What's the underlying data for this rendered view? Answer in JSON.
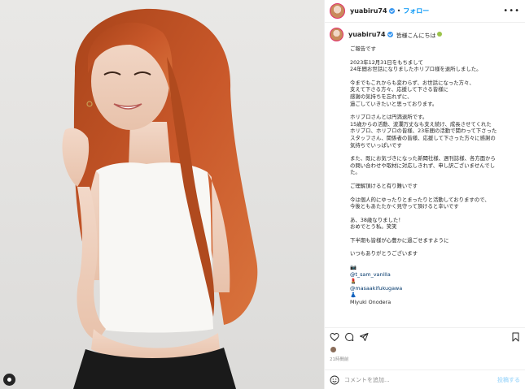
{
  "post": {
    "username": "yuabiru74",
    "follow_label": "フォロー",
    "dot": "•",
    "more_label": "•••"
  },
  "caption": {
    "greeting": "皆様こんにちは",
    "lines": [
      "ご報告です",
      "",
      "2023年12月31日をもちまして",
      "24年間お世話になりましたホリプロ様を退所しました。",
      "",
      "今までもこれからも変わらず、お世話になった方々、",
      "支えて下さる方々、応援して下さる皆様に",
      "感謝の気持ちを忘れずに、",
      "過ごしていきたいと思っております。",
      "",
      "ホリプロさんとは円満退所です。",
      "15歳からの活動、波瀾万丈なも支え続け、成長させてくれた",
      "ホリプロ、ホリプロの皆様、23年間の活動で関わって下さった",
      "スタッフさん、関係者の皆様、応援して下さった方々に感謝の",
      "気持ちでいっぱいです",
      "",
      "また、既にお気づきになった新聞社様、週刊誌様、各方面から",
      "の問い合わせや取材に対応しきれず、申し訳ございませんでし",
      "た。",
      "",
      "ご理解頂けると有り難いです",
      "",
      "今は個人的にゆったりとまったりと活動しておりますので、",
      "今後ともあたたかく見守って頂けると幸いです",
      "",
      "あ、38歳なりました！",
      "おめでとう私。笑笑",
      "",
      "下半期も皆様が心豊かに過ごせますように",
      "",
      "いつもありがとうございます"
    ],
    "credits": [
      {
        "icon": "📷",
        "text": "@t_sam_vanilla"
      },
      {
        "icon": "💄",
        "text": "@masaakifukugawa"
      },
      {
        "icon": "👗",
        "text": "Miyuki Onodera"
      }
    ]
  },
  "engagement": {
    "likes_text": "",
    "date_text": "21時間前"
  },
  "comment": {
    "placeholder": "コメントを追加...",
    "post_label": "投稿する"
  },
  "colors": {
    "accent": "#0095f6",
    "verified": "#3897f0",
    "hair": "#c0521f",
    "top": "#f8f7f4",
    "skirt": "#1a1a1a"
  }
}
